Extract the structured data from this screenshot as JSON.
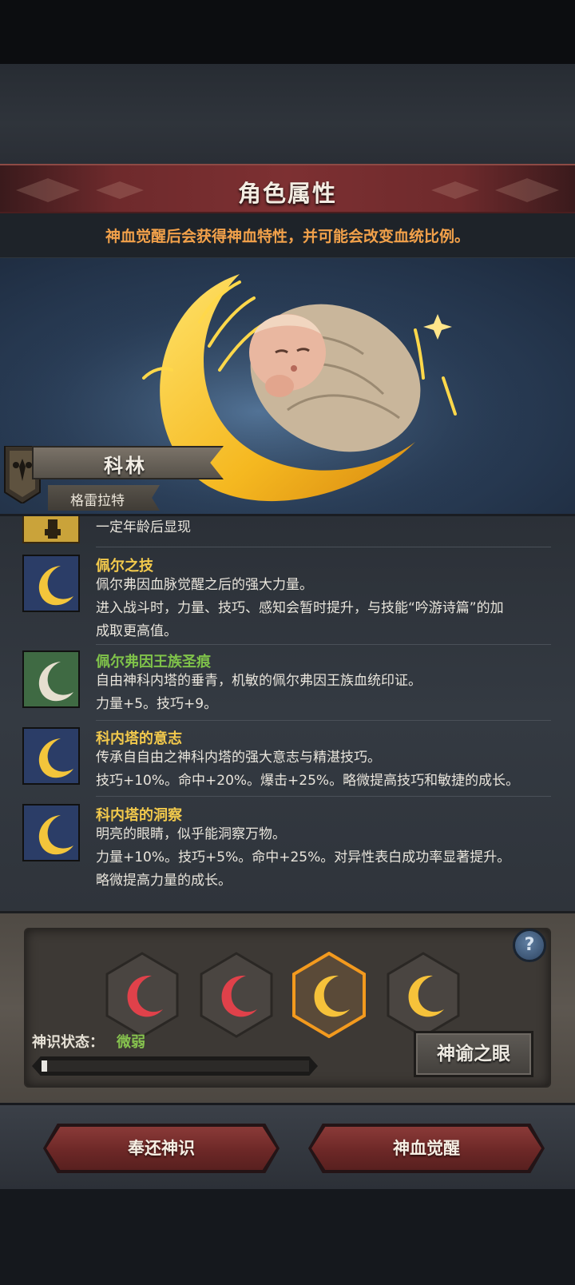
{
  "header": {
    "title": "角色属性",
    "info": "神血觉醒后会获得神血特性，并可能会改变血统比例。"
  },
  "character": {
    "name": "科林",
    "lineage": "格雷拉特"
  },
  "traits": [
    {
      "name": "",
      "icon": "locked-trait-icon",
      "lines": [
        "一定年龄后显现"
      ]
    },
    {
      "name": "佩尔之技",
      "icon": "crescent-moon-icon",
      "name_color": "#f2c94c",
      "lines": [
        "佩尔弗因血脉觉醒之后的强大力量。",
        "进入战斗时，力量、技巧、感知会暂时提升，与技能“吟游诗篇”的加",
        "成取更高值。"
      ]
    },
    {
      "name": "佩尔弗因王族圣痕",
      "icon": "silver-crescent-icon",
      "name_color": "#7fc24a",
      "lines": [
        "自由神科内塔的垂青，机敏的佩尔弗因王族血统印证。",
        "力量+5。技巧+9。"
      ]
    },
    {
      "name": "科内塔的意志",
      "icon": "crescent-moon-icon",
      "name_color": "#f2c94c",
      "lines": [
        "传承自自由之神科内塔的强大意志与精湛技巧。",
        "技巧+10%。命中+20%。爆击+25%。略微提高技巧和敏捷的成长。"
      ]
    },
    {
      "name": "科内塔的洞察",
      "icon": "crescent-moon-icon",
      "name_color": "#f2c94c",
      "lines": [
        "明亮的眼睛，似乎能洞察万物。",
        "力量+10%。技巧+5%。命中+25%。对异性表白成功率显著提升。",
        "略微提高力量的成长。"
      ]
    }
  ],
  "awakening": {
    "slots": [
      {
        "color": "red",
        "icon": "red-crescent-icon",
        "selected": false
      },
      {
        "color": "red",
        "icon": "red-crescent-icon",
        "selected": false
      },
      {
        "color": "gold",
        "icon": "gold-crescent-icon",
        "selected": true
      },
      {
        "color": "gold",
        "icon": "gold-crescent-icon",
        "selected": false
      }
    ],
    "help_label": "?",
    "state_label": "神识状态：",
    "state_value": "微弱",
    "progress": 0.02,
    "oracle_button": "神谕之眼"
  },
  "actions": {
    "return_label": "奉还神识",
    "awaken_label": "神血觉醒"
  },
  "colors": {
    "gold": "#f2c94c",
    "green": "#7fc24a",
    "orange_text": "#f2a14a",
    "banner_red": "#7d3032"
  }
}
